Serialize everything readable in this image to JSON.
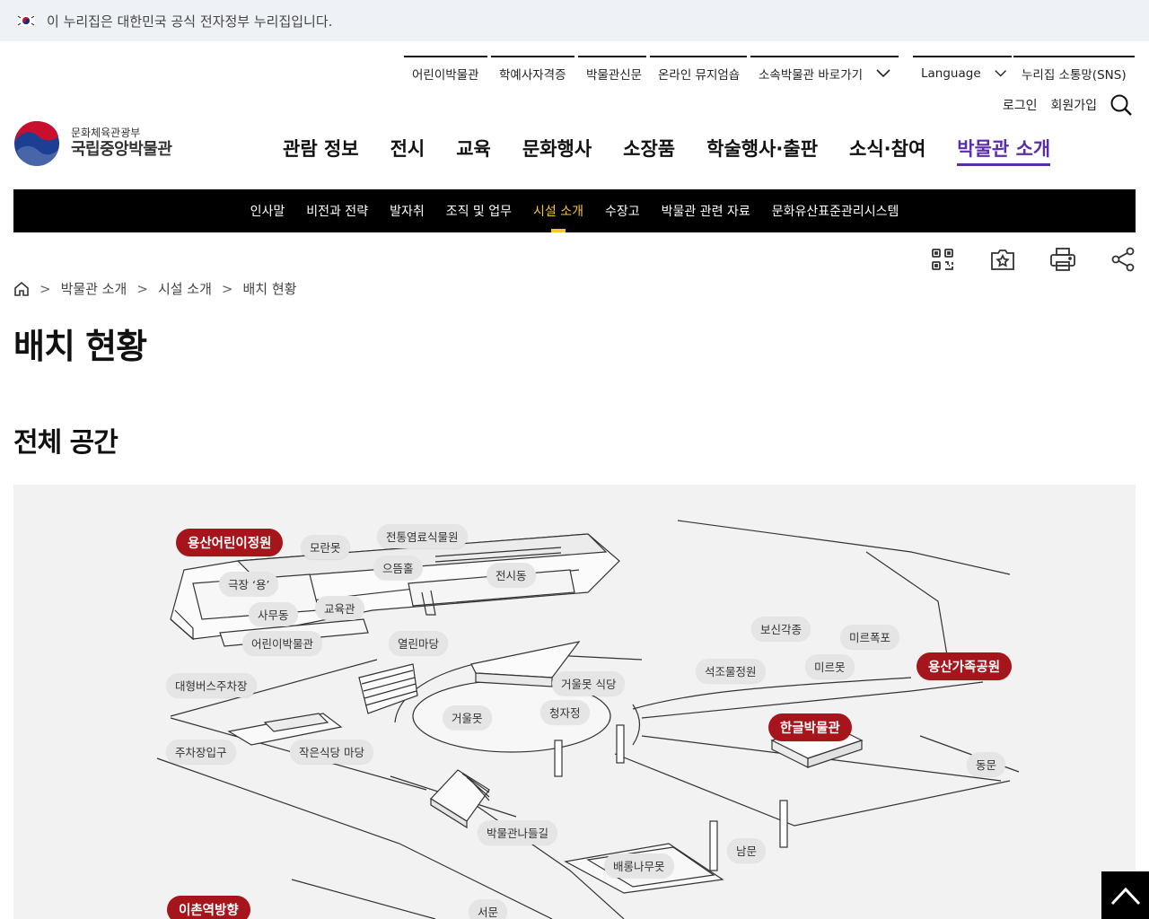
{
  "gov_bar": {
    "text": "이 누리집은 대한민국 공식 전자정부 누리집입니다."
  },
  "utility": {
    "links": [
      "어린이박물관",
      "학예사자격증",
      "박물관신문",
      "온라인 뮤지엄숍",
      "소속박물관 바로가기"
    ],
    "language": "Language",
    "sns": "누리집 소통망(SNS)",
    "login": "로그인",
    "signup": "회원가입"
  },
  "logo": {
    "ministry": "문화체육관광부",
    "name": "국립중앙박물관"
  },
  "gnb": [
    "관람 정보",
    "전시",
    "교육",
    "문화행사",
    "소장품",
    "학술행사·출판",
    "소식·참여",
    "박물관 소개"
  ],
  "sub_nav": [
    "인사말",
    "비전과 전략",
    "발자취",
    "조직 및 업무",
    "시설 소개",
    "수장고",
    "박물관 관련 자료",
    "문화유산표준관리시스템"
  ],
  "breadcrumb": [
    "박물관 소개",
    "시설 소개",
    "배치 현황"
  ],
  "page_title": "배치 현황",
  "section_title": "전체 공간",
  "map": {
    "red_labels": [
      "용산어린이정원",
      "용산가족공원",
      "한글박물관",
      "이촌역방향"
    ],
    "labels": [
      "모란못",
      "전통염료식물원",
      "으뜸홀",
      "전시동",
      "극장 ‘용’",
      "사무동",
      "교육관",
      "어린이박물관",
      "열린마당",
      "보신각종",
      "미르폭포",
      "석조물정원",
      "미르못",
      "대형버스주차장",
      "거울못 식당",
      "청자정",
      "거울못",
      "주차장입구",
      "작은식당 마당",
      "동문",
      "박물관나들길",
      "남문",
      "배롱나무못",
      "서문"
    ]
  },
  "colors": {
    "accent": "#5a2ea6",
    "highlight": "#f7c531",
    "map_red": "#a5151b"
  }
}
